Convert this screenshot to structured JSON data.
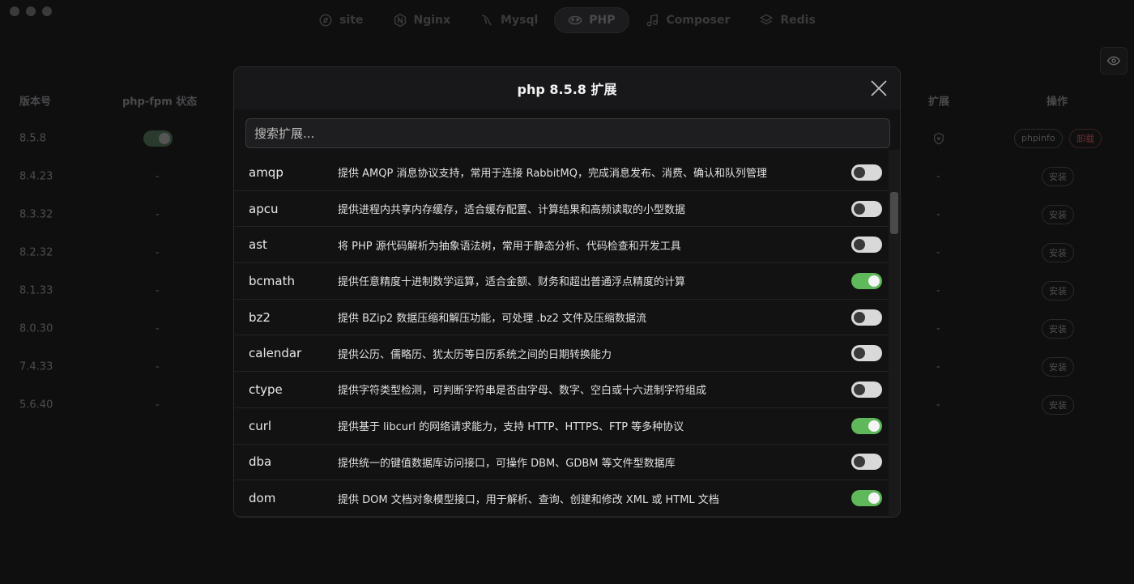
{
  "nav": {
    "tabs": [
      {
        "label": "site",
        "icon": "compass-icon"
      },
      {
        "label": "Nginx",
        "icon": "nginx-icon"
      },
      {
        "label": "Mysql",
        "icon": "mysql-dolphin-icon"
      },
      {
        "label": "PHP",
        "icon": "php-icon",
        "active": true
      },
      {
        "label": "Composer",
        "icon": "music-note-icon"
      },
      {
        "label": "Redis",
        "icon": "layers-icon"
      }
    ]
  },
  "table": {
    "headers": {
      "version": "版本号",
      "fpm": "php-fpm 状态",
      "ext": "扩展",
      "op": "操作"
    },
    "rows": [
      {
        "version": "8.5.8",
        "fpm": "",
        "ext": "",
        "op1": "phpinfo",
        "op2": "卸载"
      },
      {
        "version": "8.4.23",
        "fpm": "-",
        "ext": "-",
        "op1": "安装"
      },
      {
        "version": "8.3.32",
        "fpm": "-",
        "ext": "-",
        "op1": "安装"
      },
      {
        "version": "8.2.32",
        "fpm": "-",
        "ext": "-",
        "op1": "安装"
      },
      {
        "version": "8.1.33",
        "fpm": "-",
        "ext": "-",
        "op1": "安装"
      },
      {
        "version": "8.0.30",
        "fpm": "-",
        "ext": "-",
        "op1": "安装"
      },
      {
        "version": "7.4.33",
        "fpm": "-",
        "ext": "-",
        "op1": "安装"
      },
      {
        "version": "5.6.40",
        "fpm": "-",
        "ext": "-",
        "op1": "安装"
      }
    ]
  },
  "modal": {
    "title": "php 8.5.8 扩展",
    "search_placeholder": "搜索扩展...",
    "extensions": [
      {
        "name": "amqp",
        "desc": "提供 AMQP 消息协议支持，常用于连接 RabbitMQ，完成消息发布、消费、确认和队列管理",
        "enabled": false
      },
      {
        "name": "apcu",
        "desc": "提供进程内共享内存缓存，适合缓存配置、计算结果和高频读取的小型数据",
        "enabled": false
      },
      {
        "name": "ast",
        "desc": "将 PHP 源代码解析为抽象语法树，常用于静态分析、代码检查和开发工具",
        "enabled": false
      },
      {
        "name": "bcmath",
        "desc": "提供任意精度十进制数学运算，适合金额、财务和超出普通浮点精度的计算",
        "enabled": true
      },
      {
        "name": "bz2",
        "desc": "提供 BZip2 数据压缩和解压功能，可处理 .bz2 文件及压缩数据流",
        "enabled": false
      },
      {
        "name": "calendar",
        "desc": "提供公历、儒略历、犹太历等日历系统之间的日期转换能力",
        "enabled": false
      },
      {
        "name": "ctype",
        "desc": "提供字符类型检测，可判断字符串是否由字母、数字、空白或十六进制字符组成",
        "enabled": false
      },
      {
        "name": "curl",
        "desc": "提供基于 libcurl 的网络请求能力，支持 HTTP、HTTPS、FTP 等多种协议",
        "enabled": true
      },
      {
        "name": "dba",
        "desc": "提供统一的键值数据库访问接口，可操作 DBM、GDBM 等文件型数据库",
        "enabled": false
      },
      {
        "name": "dom",
        "desc": "提供 DOM 文档对象模型接口，用于解析、查询、创建和修改 XML 或 HTML 文档",
        "enabled": true
      }
    ]
  },
  "colors": {
    "toggle_on": "#5fb85a",
    "toggle_off": "#d9d9d9"
  }
}
